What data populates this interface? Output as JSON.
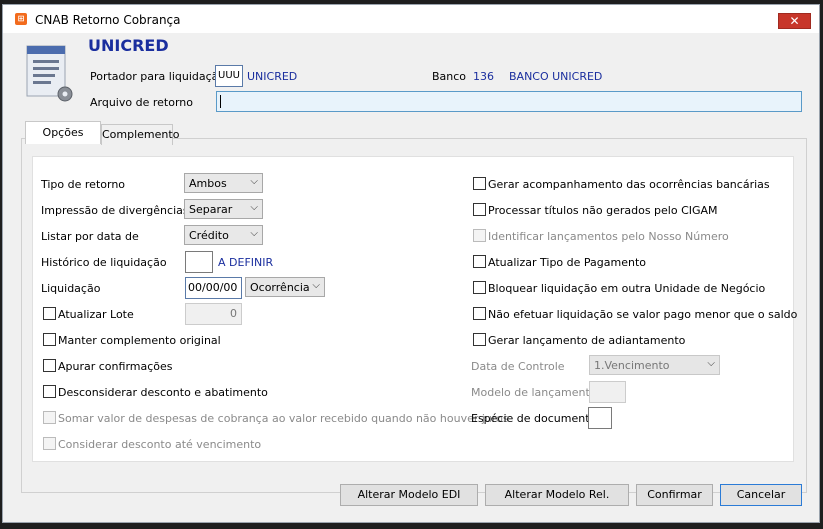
{
  "window": {
    "title": "CNAB Retorno Cobrança"
  },
  "header": {
    "bank_name": "UNICRED",
    "portador_label": "Portador para liquidação",
    "portador_code": "UUU",
    "portador_name": "UNICRED",
    "banco_label": "Banco",
    "banco_code": "136",
    "banco_name": "BANCO UNICRED",
    "arquivo_label": "Arquivo de retorno",
    "arquivo_value": ""
  },
  "tabs": [
    "Opções",
    "Complemento"
  ],
  "left": {
    "tipo_retorno_label": "Tipo de retorno",
    "tipo_retorno_value": "Ambos",
    "impressao_label": "Impressão de divergências",
    "impressao_value": "Separar",
    "listar_label": "Listar por data de",
    "listar_value": "Crédito",
    "historico_label": "Histórico de liquidação",
    "historico_value": "",
    "historico_desc": "A DEFINIR",
    "liquidacao_label": "Liquidação",
    "liquidacao_date": "00/00/00",
    "liquidacao_type": "Ocorrência",
    "atualizar_lote_label": "Atualizar Lote",
    "atualizar_lote_value": "0",
    "manter_label": "Manter complemento original",
    "apurar_label": "Apurar confirmações",
    "desconsiderar_label": "Desconsiderar desconto e abatimento",
    "somar_label": "Somar valor de despesas de cobrança ao valor recebido quando não houver juros",
    "considerar_label": "Considerar desconto até vencimento"
  },
  "right": {
    "gerar_acomp_label": "Gerar acompanhamento das ocorrências bancárias",
    "processar_label": "Processar títulos não gerados pelo CIGAM",
    "identificar_label": "Identificar lançamentos pelo Nosso Número",
    "atualizar_tipo_label": "Atualizar Tipo de Pagamento",
    "bloquear_label": "Bloquear liquidação em outra Unidade de Negócio",
    "nao_efetuar_label": "Não efetuar liquidação se valor pago menor que o saldo",
    "gerar_adiant_label": "Gerar lançamento de adiantamento",
    "data_controle_label": "Data de Controle",
    "data_controle_value": "1.Vencimento",
    "modelo_label": "Modelo de lançamento",
    "especie_label": "Espécie de documento"
  },
  "buttons": {
    "edi": "Alterar Modelo EDI",
    "rel": "Alterar Modelo Rel.",
    "confirmar": "Confirmar",
    "cancelar": "Cancelar"
  }
}
